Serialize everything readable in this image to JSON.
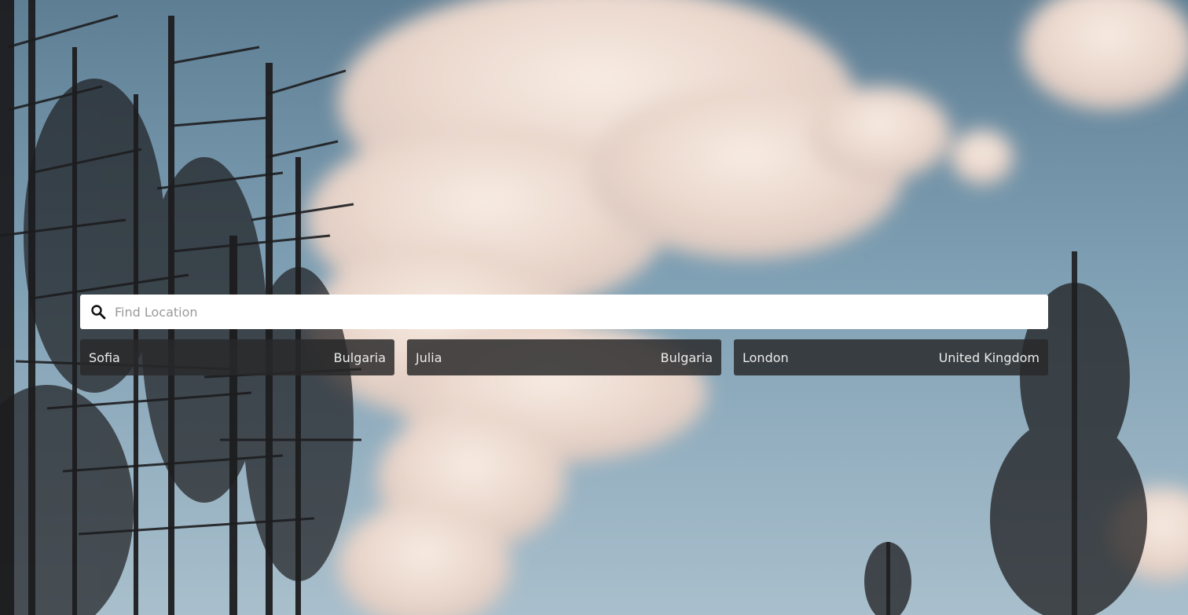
{
  "search": {
    "placeholder": "Find Location",
    "value": ""
  },
  "results": [
    {
      "city": "Sofia",
      "country": "Bulgaria"
    },
    {
      "city": "Julia",
      "country": "Bulgaria"
    },
    {
      "city": "London",
      "country": "United Kingdom"
    }
  ],
  "icons": {
    "search": "search-icon"
  },
  "colors": {
    "card_background": "#28282a",
    "search_background": "#ffffff"
  }
}
